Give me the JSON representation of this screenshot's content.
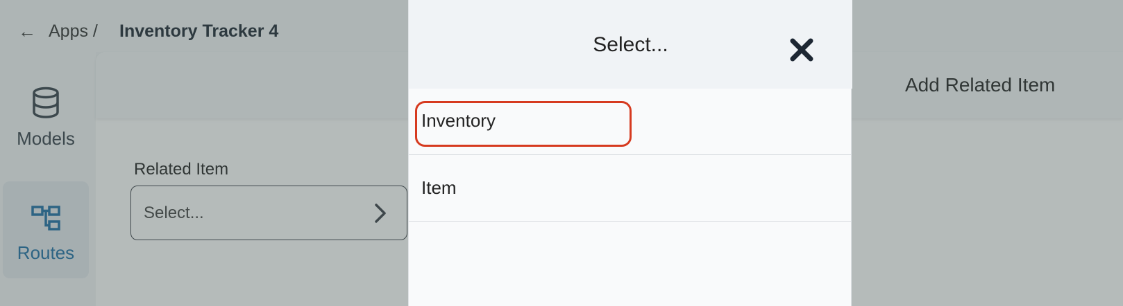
{
  "breadcrumb": {
    "back_icon": "arrow-left-icon",
    "parent": "Apps /",
    "current": "Inventory Tracker 4"
  },
  "sidebar": {
    "items": [
      {
        "label": "Models",
        "icon": "database-icon",
        "active": false
      },
      {
        "label": "Routes",
        "icon": "routes-icon",
        "active": true
      }
    ]
  },
  "panel": {
    "title": "Add Related Item",
    "field_label": "Related Item",
    "select_value": "Select..."
  },
  "modal": {
    "title": "Select...",
    "close_icon": "close-icon",
    "options": [
      {
        "label": "Inventory",
        "highlighted": true
      },
      {
        "label": "Item",
        "highlighted": false
      }
    ]
  },
  "colors": {
    "accent": "#1d6fa5",
    "highlight": "#d63a1f",
    "overlay": "#8a9694"
  }
}
